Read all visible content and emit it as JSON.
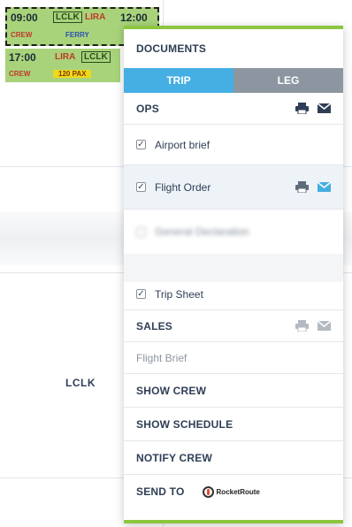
{
  "background": {
    "cell_label": "LCLK"
  },
  "flights": [
    {
      "time": "09:00",
      "from": "LCLK",
      "to": "LIRA",
      "next_time": "12:00",
      "crew_label": "CREW",
      "type_label": "FERRY"
    },
    {
      "time": "17:00",
      "from": "LIRA",
      "to": "LCLK",
      "crew_label": "CREW",
      "pax_label": "120 PAX"
    }
  ],
  "menu": {
    "documents_header": "DOCUMENTS",
    "tabs": [
      {
        "label": "TRIP",
        "active": true
      },
      {
        "label": "LEG",
        "active": false
      }
    ],
    "ops_header": "OPS",
    "ops_items": [
      {
        "label": "Airport brief",
        "checked": true
      },
      {
        "label": "Flight Order",
        "checked": true
      },
      {
        "label": "General Declaration",
        "checked": false
      },
      {
        "label": "Trip Sheet",
        "checked": true
      }
    ],
    "sales_header": "SALES",
    "flight_brief": "Flight Brief",
    "show_crew": "SHOW CREW",
    "show_schedule": "SHOW SCHEDULE",
    "notify_crew": "NOTIFY CREW",
    "send_to": "SEND TO",
    "rocketroute": "RocketRoute",
    "check_mark": "✓"
  },
  "colors": {
    "accent_green": "#8cc63f",
    "tab_active": "#45aee3",
    "tab_inactive": "#8d96a0",
    "flight_green": "#a8d37a",
    "mail_blue": "#45aee3"
  },
  "icons": [
    "printer-icon",
    "mail-icon",
    "checkbox-icon",
    "rocketroute-logo"
  ]
}
